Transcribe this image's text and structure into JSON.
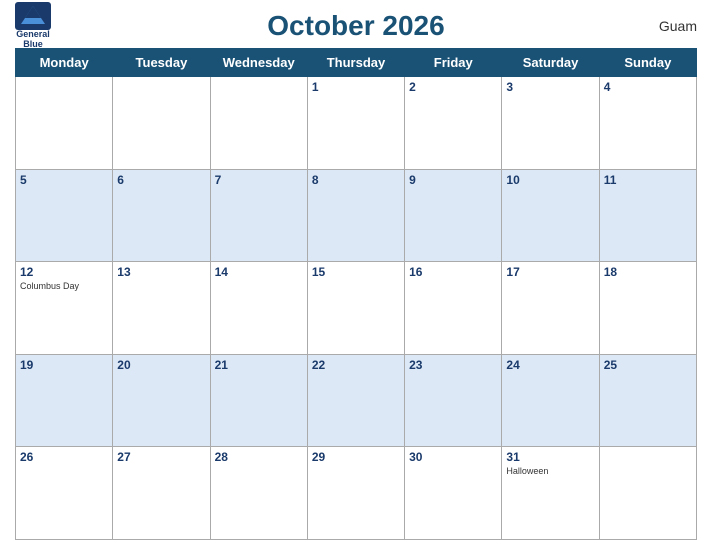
{
  "header": {
    "title": "October 2026",
    "region": "Guam",
    "logo_line1": "General",
    "logo_line2": "Blue"
  },
  "weekdays": [
    "Monday",
    "Tuesday",
    "Wednesday",
    "Thursday",
    "Friday",
    "Saturday",
    "Sunday"
  ],
  "weeks": [
    [
      {
        "day": "",
        "event": ""
      },
      {
        "day": "",
        "event": ""
      },
      {
        "day": "",
        "event": ""
      },
      {
        "day": "1",
        "event": ""
      },
      {
        "day": "2",
        "event": ""
      },
      {
        "day": "3",
        "event": ""
      },
      {
        "day": "4",
        "event": ""
      }
    ],
    [
      {
        "day": "5",
        "event": ""
      },
      {
        "day": "6",
        "event": ""
      },
      {
        "day": "7",
        "event": ""
      },
      {
        "day": "8",
        "event": ""
      },
      {
        "day": "9",
        "event": ""
      },
      {
        "day": "10",
        "event": ""
      },
      {
        "day": "11",
        "event": ""
      }
    ],
    [
      {
        "day": "12",
        "event": "Columbus Day"
      },
      {
        "day": "13",
        "event": ""
      },
      {
        "day": "14",
        "event": ""
      },
      {
        "day": "15",
        "event": ""
      },
      {
        "day": "16",
        "event": ""
      },
      {
        "day": "17",
        "event": ""
      },
      {
        "day": "18",
        "event": ""
      }
    ],
    [
      {
        "day": "19",
        "event": ""
      },
      {
        "day": "20",
        "event": ""
      },
      {
        "day": "21",
        "event": ""
      },
      {
        "day": "22",
        "event": ""
      },
      {
        "day": "23",
        "event": ""
      },
      {
        "day": "24",
        "event": ""
      },
      {
        "day": "25",
        "event": ""
      }
    ],
    [
      {
        "day": "26",
        "event": ""
      },
      {
        "day": "27",
        "event": ""
      },
      {
        "day": "28",
        "event": ""
      },
      {
        "day": "29",
        "event": ""
      },
      {
        "day": "30",
        "event": ""
      },
      {
        "day": "31",
        "event": "Halloween"
      },
      {
        "day": "",
        "event": ""
      }
    ]
  ]
}
